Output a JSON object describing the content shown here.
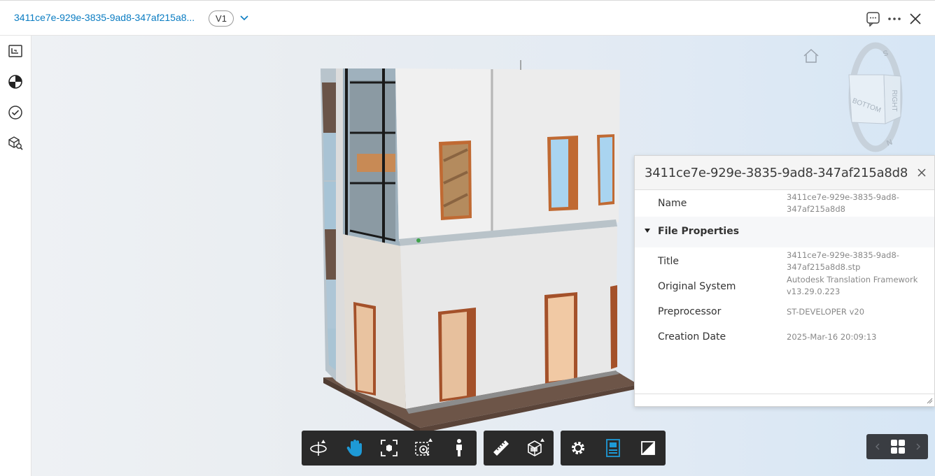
{
  "header": {
    "file_title": "3411ce7e-929e-3835-9ad8-347af215a8...",
    "version": "V1",
    "icons": [
      "chevron-down-icon",
      "comment-icon",
      "more-icon",
      "close-icon"
    ]
  },
  "sidebar": {
    "items": [
      {
        "name": "sheets-views-icon"
      },
      {
        "name": "model-browser-icon"
      },
      {
        "name": "issues-icon"
      },
      {
        "name": "search-model-icon"
      }
    ]
  },
  "properties_panel": {
    "title": "3411ce7e-929e-3835-9ad8-347af215a8d8",
    "name_label": "Name",
    "name_value": "3411ce7e-929e-3835-9ad8-347af215a8d8",
    "section": "File Properties",
    "rows": [
      {
        "label": "Title",
        "value": "3411ce7e-929e-3835-9ad8-347af215a8d8.stp"
      },
      {
        "label": "Original System",
        "value": "Autodesk Translation Framework v13.29.0.223"
      },
      {
        "label": "Preprocessor",
        "value": "ST-DEVELOPER v20"
      },
      {
        "label": "Creation Date",
        "value": "2025-Mar-16 20:09:13"
      }
    ]
  },
  "viewcube": {
    "faces": [
      "BOTTOM",
      "RIGHT"
    ],
    "compass": [
      "S",
      "N"
    ]
  },
  "toolbar": {
    "navigation": [
      "orbit-icon",
      "pan-icon",
      "fit-to-view-icon",
      "zoom-window-icon",
      "first-person-icon"
    ],
    "analysis": [
      "measure-icon",
      "section-analysis-icon"
    ],
    "settings": [
      "settings-icon",
      "properties-icon",
      "fullscreen-icon"
    ],
    "active_tools": [
      "pan-icon",
      "properties-icon"
    ],
    "accent_color": "#1e9ad6"
  },
  "colors": {
    "link": "#0a7cc2",
    "toolbar_bg": "#2a2a2a"
  }
}
